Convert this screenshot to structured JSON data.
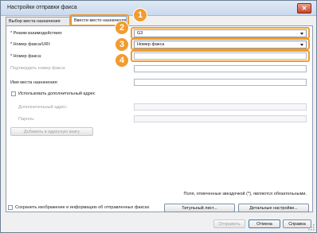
{
  "window": {
    "title": "Настройки отправки факса"
  },
  "tabs": [
    {
      "label": "Выбор места назначения"
    },
    {
      "label": "Ввести место назначения"
    }
  ],
  "form": {
    "comm_mode": {
      "label": "* Режим взаимодействия:",
      "value": "G3"
    },
    "number_uri": {
      "label": "* Номер факса/URI:",
      "value": "Номер факса"
    },
    "fax_number": {
      "label": "* Номер факса:",
      "value": ""
    },
    "confirm_fax": {
      "label": "Подтвердить номер факса:",
      "value": ""
    },
    "dest_name": {
      "label": "Имя места назначения:",
      "value": ""
    },
    "use_extra": {
      "label": "Использовать дополнительный адрес"
    },
    "extra_address": {
      "label": "Дополнительный адрес:",
      "value": ""
    },
    "password": {
      "label": "Пароль:",
      "value": ""
    },
    "add_to_book": {
      "label": "Добавить в адресную книгу"
    }
  },
  "required_note": "Поля, отмеченные звездочкой (*), являются обязательными.",
  "bottom": {
    "save_info": "Сохранить изображение и информацию об отправленных факсах",
    "cover_sheet": "Титульный лист...",
    "detailed": "Детальные настройки..."
  },
  "footer": {
    "send": "Отправить",
    "cancel": "Отмена",
    "help": "Справка"
  },
  "badges": [
    "1",
    "2",
    "3",
    "4"
  ],
  "colors": {
    "accent": "#f29b2e"
  }
}
